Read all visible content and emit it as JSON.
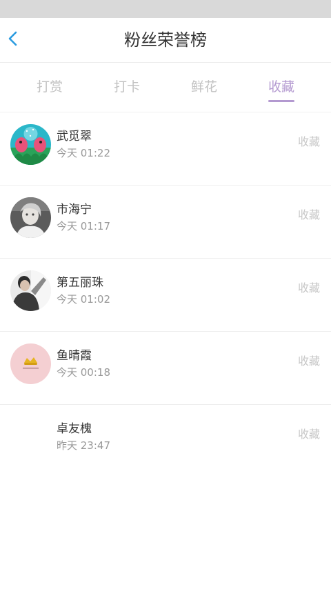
{
  "header": {
    "title": "粉丝荣誉榜",
    "back_icon": "chevron-left-icon",
    "accent_color": "#2a9be0"
  },
  "tabs": [
    {
      "label": "打赏",
      "active": false
    },
    {
      "label": "打卡",
      "active": false
    },
    {
      "label": "鲜花",
      "active": false
    },
    {
      "label": "收藏",
      "active": true
    }
  ],
  "active_tab_color": "#b399d0",
  "fans": [
    {
      "name": "武觅翠",
      "time": "今天 01:22",
      "action": "收藏",
      "avatar": "cartoon-avatar"
    },
    {
      "name": "市海宁",
      "time": "今天 01:17",
      "action": "收藏",
      "avatar": "photo-avatar"
    },
    {
      "name": "第五丽珠",
      "time": "今天 01:02",
      "action": "收藏",
      "avatar": "photo-avatar"
    },
    {
      "name": "鱼晴霞",
      "time": "今天 00:18",
      "action": "收藏",
      "avatar": "logo-avatar"
    },
    {
      "name": "卓友槐",
      "time": "昨天 23:47",
      "action": "收藏",
      "avatar": "empty-avatar"
    }
  ]
}
